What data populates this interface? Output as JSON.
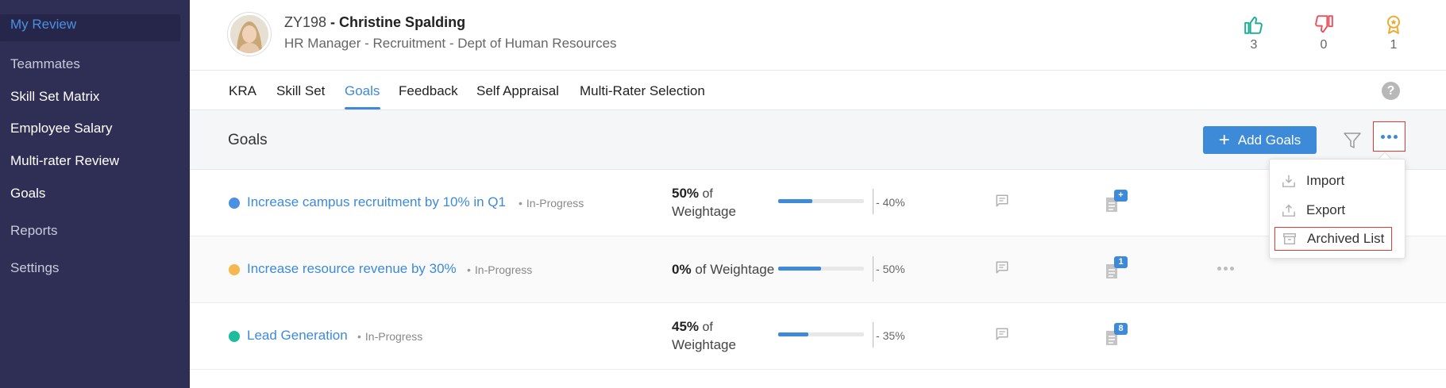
{
  "sidebar": {
    "items": [
      {
        "label": "My Review",
        "active": true
      },
      {
        "label": "Teammates"
      },
      {
        "label": "Skill Set Matrix"
      },
      {
        "label": "Employee Salary"
      },
      {
        "label": "Multi-rater Review"
      },
      {
        "label": "Goals"
      },
      {
        "label": "Reports"
      },
      {
        "label": "Settings"
      }
    ]
  },
  "employee": {
    "id": "ZY198",
    "separator": " - ",
    "name": "Christine Spalding",
    "subtitle": "HR Manager - Recruitment - Dept of Human Resources"
  },
  "stats": {
    "likes": {
      "icon": "thumbs-up-icon",
      "count": "3",
      "color": "#1aaf94"
    },
    "dislikes": {
      "icon": "thumbs-down-icon",
      "count": "0",
      "color": "#e8545e"
    },
    "awards": {
      "icon": "award-icon",
      "count": "1",
      "color": "#f0a830"
    }
  },
  "tabs": [
    {
      "label": "KRA"
    },
    {
      "label": "Skill Set"
    },
    {
      "label": "Goals",
      "active": true
    },
    {
      "label": "Feedback"
    },
    {
      "label": "Self Appraisal"
    },
    {
      "label": "Multi-Rater Selection"
    }
  ],
  "help": {
    "label": "?"
  },
  "toolbar": {
    "title": "Goals",
    "add_label": "Add Goals",
    "add_icon": "+"
  },
  "goals": [
    {
      "title": "Increase campus recruitment by 10% in Q1",
      "status": "In-Progress",
      "dot_color": "#4a90e2",
      "weight_value": "50%",
      "weight_text": "of Weightage",
      "progress": 40,
      "progress_label": "40%",
      "badge": "+"
    },
    {
      "title": "Increase resource revenue by 30%",
      "status": "In-Progress",
      "dot_color": "#f5b74e",
      "weight_value": "0%",
      "weight_text": "of Weightage",
      "progress": 50,
      "progress_label": "50%",
      "badge": "1"
    },
    {
      "title": "Lead Generation",
      "status": "In-Progress",
      "dot_color": "#1cbc9c",
      "weight_value": "45%",
      "weight_text": "of Weightage",
      "progress": 35,
      "progress_label": "35%",
      "badge": "8"
    }
  ],
  "progress_prefix": "- ",
  "dropdown": {
    "items": [
      {
        "label": "Import",
        "icon": "import-icon"
      },
      {
        "label": "Export",
        "icon": "export-icon"
      },
      {
        "label": "Archived List",
        "icon": "archive-icon",
        "highlighted": true
      }
    ]
  },
  "colors": {
    "sidebar_bg": "#2f2f55",
    "accent": "#3d8ad9",
    "highlight_border": "#e53935"
  }
}
